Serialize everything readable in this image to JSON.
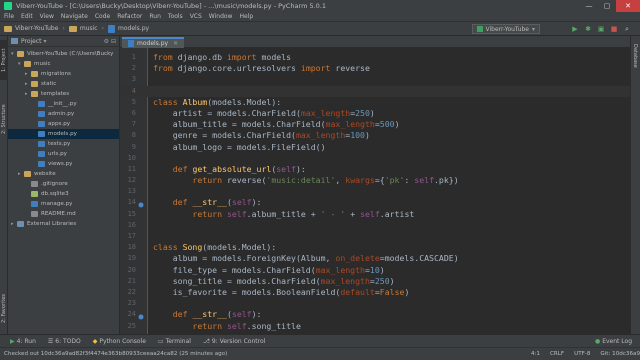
{
  "window": {
    "title": "Viberr-YouTube - [C:\\Users\\Bucky\\Desktop\\Viberr-YouTube] - ...\\music\\models.py - PyCharm 5.0.1"
  },
  "menu": [
    "File",
    "Edit",
    "View",
    "Navigate",
    "Code",
    "Refactor",
    "Run",
    "Tools",
    "VCS",
    "Window",
    "Help"
  ],
  "navbar": {
    "crumbs": [
      "Viberr-YouTube",
      "music",
      "models.py"
    ],
    "run_config": "Viberr-YouTube"
  },
  "project_panel": {
    "title": "Project",
    "tree": [
      {
        "label": "Viberr-YouTube  (C:\\Users\\Bucky",
        "icon": "folder",
        "arrow": "▾",
        "indent": 0
      },
      {
        "label": "music",
        "icon": "folder",
        "arrow": "▾",
        "indent": 1
      },
      {
        "label": "migrations",
        "icon": "folder",
        "arrow": "▸",
        "indent": 2
      },
      {
        "label": "static",
        "icon": "folder",
        "arrow": "▸",
        "indent": 2
      },
      {
        "label": "templates",
        "icon": "folder",
        "arrow": "▸",
        "indent": 2
      },
      {
        "label": "__init__.py",
        "icon": "py",
        "arrow": "",
        "indent": 3
      },
      {
        "label": "admin.py",
        "icon": "py",
        "arrow": "",
        "indent": 3
      },
      {
        "label": "apps.py",
        "icon": "py",
        "arrow": "",
        "indent": 3
      },
      {
        "label": "models.py",
        "icon": "py",
        "arrow": "",
        "indent": 3,
        "selected": true
      },
      {
        "label": "tests.py",
        "icon": "py",
        "arrow": "",
        "indent": 3
      },
      {
        "label": "urls.py",
        "icon": "py",
        "arrow": "",
        "indent": 3
      },
      {
        "label": "views.py",
        "icon": "py",
        "arrow": "",
        "indent": 3
      },
      {
        "label": "website",
        "icon": "folder",
        "arrow": "▸",
        "indent": 1
      },
      {
        "label": ".gitignore",
        "icon": "file",
        "arrow": "",
        "indent": 2
      },
      {
        "label": "db.sqlite3",
        "icon": "db",
        "arrow": "",
        "indent": 2
      },
      {
        "label": "manage.py",
        "icon": "py",
        "arrow": "",
        "indent": 2
      },
      {
        "label": "README.md",
        "icon": "file",
        "arrow": "",
        "indent": 2
      },
      {
        "label": "External Libraries",
        "icon": "lib",
        "arrow": "▸",
        "indent": 0
      }
    ]
  },
  "left_strip": {
    "project": "1: Project",
    "structure": "2: Structure",
    "favorites": "2: Favorites"
  },
  "right_strip": {
    "database": "Database"
  },
  "editor": {
    "tab": "models.py",
    "lines": [
      {
        "n": "1",
        "tokens": [
          [
            "kw",
            "from"
          ],
          [
            "t",
            " django.db "
          ],
          [
            "kw",
            "import"
          ],
          [
            "t",
            " models"
          ]
        ]
      },
      {
        "n": "2",
        "tokens": [
          [
            "kw",
            "from"
          ],
          [
            "t",
            " django.core.urlresolvers "
          ],
          [
            "kw",
            "import"
          ],
          [
            "t",
            " reverse"
          ]
        ]
      },
      {
        "n": "3",
        "tokens": []
      },
      {
        "n": "4",
        "tokens": [],
        "current": true
      },
      {
        "n": "5",
        "tokens": [
          [
            "kw",
            "class "
          ],
          [
            "fn",
            "Album"
          ],
          [
            "t",
            "(models.Model):"
          ]
        ]
      },
      {
        "n": "6",
        "tokens": [
          [
            "t",
            "    artist = models.CharField("
          ],
          [
            "param",
            "max_length"
          ],
          [
            "t",
            "="
          ],
          [
            "num",
            "250"
          ],
          [
            "t",
            ")"
          ]
        ]
      },
      {
        "n": "7",
        "tokens": [
          [
            "t",
            "    album_title = models.CharField("
          ],
          [
            "param",
            "max_length"
          ],
          [
            "t",
            "="
          ],
          [
            "num",
            "500"
          ],
          [
            "t",
            ")"
          ]
        ]
      },
      {
        "n": "8",
        "tokens": [
          [
            "t",
            "    genre = models.CharField("
          ],
          [
            "param",
            "max_length"
          ],
          [
            "t",
            "="
          ],
          [
            "num",
            "100"
          ],
          [
            "t",
            ")"
          ]
        ]
      },
      {
        "n": "9",
        "tokens": [
          [
            "t",
            "    album_logo = models.FileField()"
          ]
        ]
      },
      {
        "n": "10",
        "tokens": []
      },
      {
        "n": "11",
        "tokens": [
          [
            "kw",
            "    def "
          ],
          [
            "fn",
            "get_absolute_url"
          ],
          [
            "t",
            "("
          ],
          [
            "self",
            "self"
          ],
          [
            "t",
            "):"
          ]
        ]
      },
      {
        "n": "12",
        "tokens": [
          [
            "kw",
            "        return "
          ],
          [
            "t",
            "reverse("
          ],
          [
            "str",
            "'music:detail'"
          ],
          [
            "t",
            ", "
          ],
          [
            "param",
            "kwargs"
          ],
          [
            "t",
            "={"
          ],
          [
            "str",
            "'pk'"
          ],
          [
            "t",
            ": "
          ],
          [
            "self",
            "self"
          ],
          [
            "t",
            ".pk})"
          ]
        ]
      },
      {
        "n": "13",
        "tokens": []
      },
      {
        "n": "14",
        "tokens": [
          [
            "kw",
            "    def "
          ],
          [
            "fn",
            "__str__"
          ],
          [
            "t",
            "("
          ],
          [
            "self",
            "self"
          ],
          [
            "t",
            "):"
          ]
        ],
        "marker": true
      },
      {
        "n": "15",
        "tokens": [
          [
            "kw",
            "        return "
          ],
          [
            "self",
            "self"
          ],
          [
            "t",
            ".album_title + "
          ],
          [
            "str",
            "' - '"
          ],
          [
            "t",
            " + "
          ],
          [
            "self",
            "self"
          ],
          [
            "t",
            ".artist"
          ]
        ]
      },
      {
        "n": "16",
        "tokens": []
      },
      {
        "n": "17",
        "tokens": []
      },
      {
        "n": "18",
        "tokens": [
          [
            "kw",
            "class "
          ],
          [
            "fn",
            "Song"
          ],
          [
            "t",
            "(models.Model):"
          ]
        ]
      },
      {
        "n": "19",
        "tokens": [
          [
            "t",
            "    album = models.ForeignKey(Album, "
          ],
          [
            "param",
            "on_delete"
          ],
          [
            "t",
            "=models.CASCADE)"
          ]
        ]
      },
      {
        "n": "20",
        "tokens": [
          [
            "t",
            "    file_type = models.CharField("
          ],
          [
            "param",
            "max_length"
          ],
          [
            "t",
            "="
          ],
          [
            "num",
            "10"
          ],
          [
            "t",
            ")"
          ]
        ]
      },
      {
        "n": "21",
        "tokens": [
          [
            "t",
            "    song_title = models.CharField("
          ],
          [
            "param",
            "max_length"
          ],
          [
            "t",
            "="
          ],
          [
            "num",
            "250"
          ],
          [
            "t",
            ")"
          ]
        ]
      },
      {
        "n": "22",
        "tokens": [
          [
            "t",
            "    is_favorite = models.BooleanField("
          ],
          [
            "param",
            "default"
          ],
          [
            "t",
            "="
          ],
          [
            "kw",
            "False"
          ],
          [
            "t",
            ")"
          ]
        ]
      },
      {
        "n": "23",
        "tokens": []
      },
      {
        "n": "24",
        "tokens": [
          [
            "kw",
            "    def "
          ],
          [
            "fn",
            "__str__"
          ],
          [
            "t",
            "("
          ],
          [
            "self",
            "self"
          ],
          [
            "t",
            "):"
          ]
        ],
        "marker": true
      },
      {
        "n": "25",
        "tokens": [
          [
            "kw",
            "        return "
          ],
          [
            "self",
            "self"
          ],
          [
            "t",
            ".song_title"
          ]
        ]
      }
    ]
  },
  "tool_windows": {
    "run": "4: Run",
    "todo": "6: TODO",
    "python_console": "Python Console",
    "terminal": "Terminal",
    "version_control": "9: Version Control",
    "event_log": "Event Log"
  },
  "status": {
    "message": "Checked out 10dc36a9ad82f3f4474e363b80933ceeaa24ca82 (25 minutes ago)",
    "position": "4:1",
    "line_sep": "CRLF",
    "encoding": "UTF-8",
    "git": "Git: 10dc36a9"
  }
}
